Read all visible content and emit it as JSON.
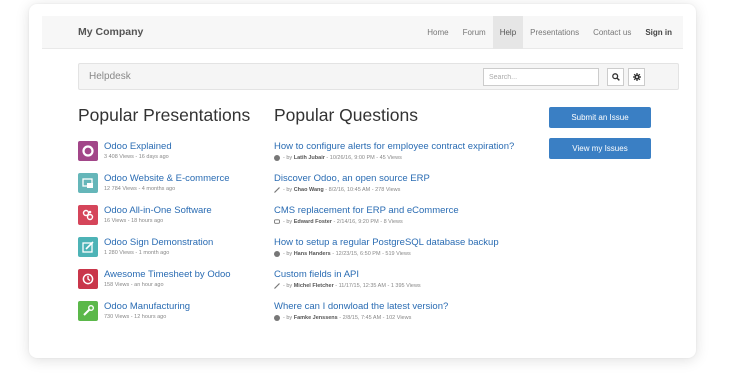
{
  "navbar": {
    "brand": "My Company",
    "items": [
      {
        "label": "Home"
      },
      {
        "label": "Forum"
      },
      {
        "label": "Help",
        "active": true
      },
      {
        "label": "Presentations"
      },
      {
        "label": "Contact us"
      },
      {
        "label": "Sign in",
        "bold": true
      }
    ]
  },
  "helpdesk": {
    "title": "Helpdesk",
    "search_placeholder": "Search..."
  },
  "presentations": {
    "heading": "Popular Presentations",
    "items": [
      {
        "title": "Odoo Explained",
        "meta": "3 408 Views - 16 days ago",
        "icon": "odoo-logo-icon",
        "color": "#a24689"
      },
      {
        "title": "Odoo Website & E-commerce",
        "meta": "12 784 Views - 4 months ago",
        "icon": "website-icon",
        "color": "#65b6b9"
      },
      {
        "title": "Odoo All-in-One Software",
        "meta": "16 Views - 18 hours ago",
        "icon": "apps-icon",
        "color": "#d5455a"
      },
      {
        "title": "Odoo Sign Demonstration",
        "meta": "1 280 Views - 1 month ago",
        "icon": "sign-icon",
        "color": "#4db3b6"
      },
      {
        "title": "Awesome Timesheet by Odoo",
        "meta": "158 Views - an hour ago",
        "icon": "timesheet-icon",
        "color": "#c9364a"
      },
      {
        "title": "Odoo Manufacturing",
        "meta": "730 Views - 12 hours ago",
        "icon": "wrench-icon",
        "color": "#5bb84a"
      }
    ]
  },
  "questions": {
    "heading": "Popular Questions",
    "by": "- by",
    "items": [
      {
        "title": "How to configure alerts for employee contract expiration?",
        "author": "Latih Jubair",
        "info": "- 10/26/16, 9:00 PM - 45 Views",
        "icon": "question-icon"
      },
      {
        "title": "Discover Odoo, an open source ERP",
        "author": "Chao Wang",
        "info": "- 8/2/16, 10:45 AM - 278 Views",
        "icon": "link-icon"
      },
      {
        "title": "CMS replacement for ERP and eCommerce",
        "author": "Edward Foster",
        "info": "- 2/14/16, 9:20 PM - 8 Views",
        "icon": "comment-icon"
      },
      {
        "title": "How to setup a regular PostgreSQL database backup",
        "author": "Hans Handers",
        "info": "- 12/23/15, 6:50 PM - 519 Views",
        "icon": "question-icon"
      },
      {
        "title": "Custom fields in API",
        "author": "Michel Fletcher",
        "info": "- 11/17/15, 12:35 AM - 1 395 Views",
        "icon": "link-icon"
      },
      {
        "title": "Where can I donwload the latest version?",
        "author": "Famke Jenssens",
        "info": "- 2/8/15, 7:45 AM - 102 Views",
        "icon": "question-icon"
      }
    ]
  },
  "actions": {
    "submit_label": "Submit an Issue",
    "view_label": "View my Issues"
  },
  "colors": {
    "accent": "#3a7fc4",
    "link": "#2a6cb3"
  }
}
